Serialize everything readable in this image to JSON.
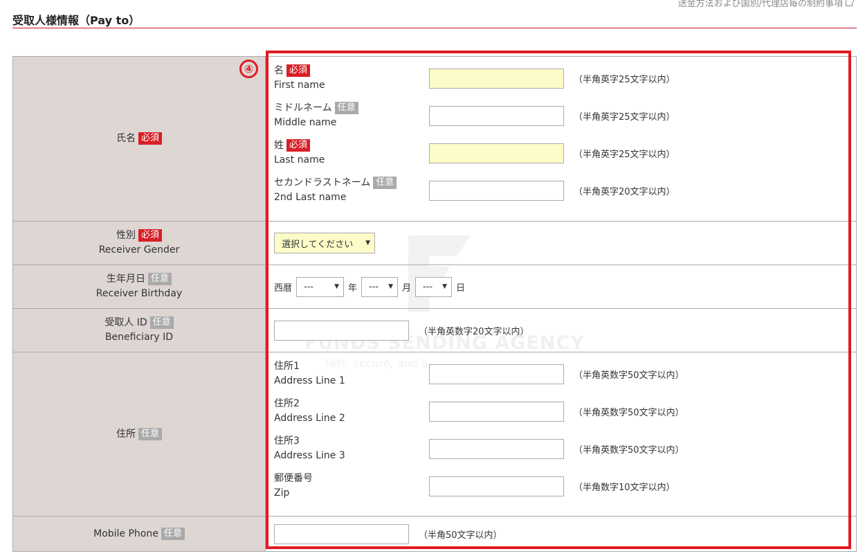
{
  "header": {
    "top_link": "送金方法および国別/代理店毎の制約事項",
    "section_title": "受取人様情報（Pay to）"
  },
  "step_number": "④",
  "badges": {
    "required": "必須",
    "optional": "任意"
  },
  "name_row": {
    "label": "氏名",
    "fields": [
      {
        "label_jp": "名",
        "label_en": "First name",
        "required": true,
        "hint": "（半角英字25文字以内）"
      },
      {
        "label_jp": "ミドルネーム",
        "label_en": "Middle name",
        "required": false,
        "hint": "（半角英字25文字以内）"
      },
      {
        "label_jp": "姓",
        "label_en": "Last name",
        "required": true,
        "hint": "（半角英字25文字以内）"
      },
      {
        "label_jp": "セカンドラストネーム",
        "label_en": "2nd Last name",
        "required": false,
        "hint": "（半角英字20文字以内）"
      }
    ]
  },
  "gender_row": {
    "label_jp": "性別",
    "label_en": "Receiver Gender",
    "select_value": "選択してください"
  },
  "birthday_row": {
    "label_jp": "生年月日",
    "label_en": "Receiver Birthday",
    "era": "西暦",
    "year_value": "---",
    "year_unit": "年",
    "month_value": "---",
    "month_unit": "月",
    "day_value": "---",
    "day_unit": "日"
  },
  "beneficiary_row": {
    "label_jp": "受取人 ID",
    "label_en": "Beneficiary ID",
    "hint": "（半角英数字20文字以内）"
  },
  "address_row": {
    "label": "住所",
    "fields": [
      {
        "label_jp": "住所1",
        "label_en": "Address Line 1",
        "hint": "（半角英数字50文字以内）"
      },
      {
        "label_jp": "住所2",
        "label_en": "Address Line 2",
        "hint": "（半角英数字50文字以内）"
      },
      {
        "label_jp": "住所3",
        "label_en": "Address Line 3",
        "hint": "（半角英数字50文字以内）"
      },
      {
        "label_jp": "郵便番号",
        "label_en": "Zip",
        "hint": "（半角数字10文字以内）"
      }
    ]
  },
  "mobile_row": {
    "label": "Mobile Phone",
    "hint": "（半角50文字以内）"
  },
  "watermark": {
    "title": "FUNDS SENDING AGENCY",
    "tagline": "fast, secure, and a"
  },
  "colors": {
    "accent_red": "#e01b24",
    "label_bg": "#ddd6d3",
    "required_field_bg": "#fdfcc8"
  }
}
